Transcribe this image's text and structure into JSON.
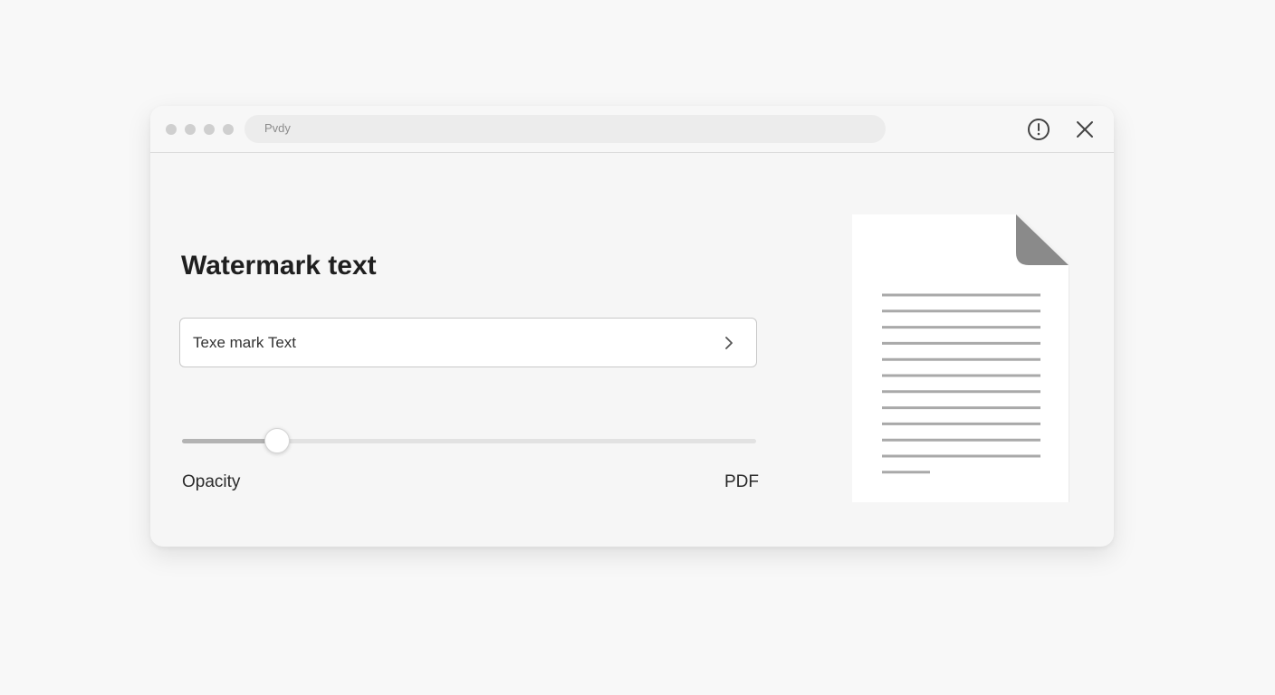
{
  "window": {
    "address_text": "Pvdy"
  },
  "titlebar": {
    "info_icon": "info-clock-icon",
    "close_icon": "close-icon"
  },
  "main": {
    "heading": "Watermark text",
    "text_input": {
      "value": "Texe mark Text",
      "action_icon": "chevron-right-icon"
    },
    "opacity_slider": {
      "level": 0.165
    },
    "opacity_label": "Opacity",
    "format_label": "PDF"
  },
  "preview": {
    "icon": "document-icon",
    "line_count": 12
  },
  "colors": {
    "background": "#f8f8f8",
    "window": "#f6f6f6",
    "text": "#1f1f1f",
    "slider_fill": "#b3b3b3",
    "doc_lines": "#a9a9a9",
    "doc_fold": "#8a8a8a"
  }
}
